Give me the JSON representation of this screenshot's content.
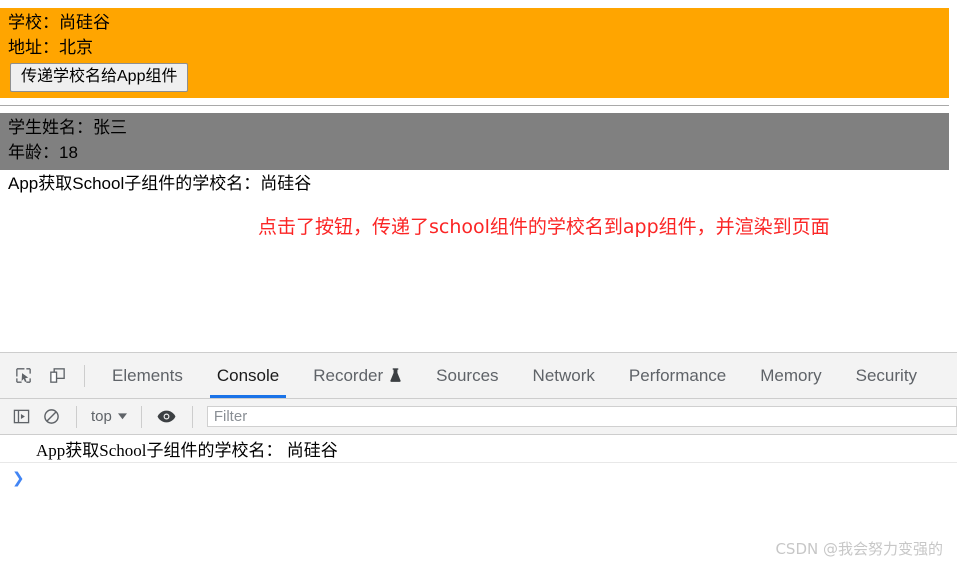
{
  "page": {
    "school_panel": {
      "bg_color": "#ffa500",
      "school_line": "学校：尚硅谷",
      "address_line": "地址：北京",
      "button_label": "传递学校名给App组件"
    },
    "student_panel": {
      "bg_color": "#808080",
      "name_line": "学生姓名：张三",
      "age_line": "年龄：18"
    },
    "app_line": "App获取School子组件的学校名：尚硅谷",
    "annotation": {
      "text": "点击了按钮，传递了school组件的学校名到app组件，并渲染到页面",
      "color": "#fb2525"
    }
  },
  "devtools": {
    "icons": {
      "inspect": "inspect-element-icon",
      "device": "device-toolbar-icon",
      "sidebar": "console-sidebar-icon",
      "clear": "clear-console-icon",
      "eye": "live-expression-eye-icon",
      "dropdown": "chevron-down-icon",
      "recorder_badge": "flask-icon"
    },
    "tabs": [
      {
        "label": "Elements",
        "active": false
      },
      {
        "label": "Console",
        "active": true
      },
      {
        "label": "Recorder",
        "active": false,
        "badge": "flask"
      },
      {
        "label": "Sources",
        "active": false
      },
      {
        "label": "Network",
        "active": false
      },
      {
        "label": "Performance",
        "active": false
      },
      {
        "label": "Memory",
        "active": false
      },
      {
        "label": "Security",
        "active": false
      }
    ],
    "active_tab_indicator_color": "#1a73e8",
    "toolbar": {
      "context_label": "top",
      "filter_placeholder": "Filter",
      "filter_value": ""
    },
    "console": {
      "messages": [
        "App获取School子组件的学校名： 尚硅谷"
      ],
      "prompt_caret": "❯"
    }
  },
  "watermark": "CSDN @我会努力变强的"
}
